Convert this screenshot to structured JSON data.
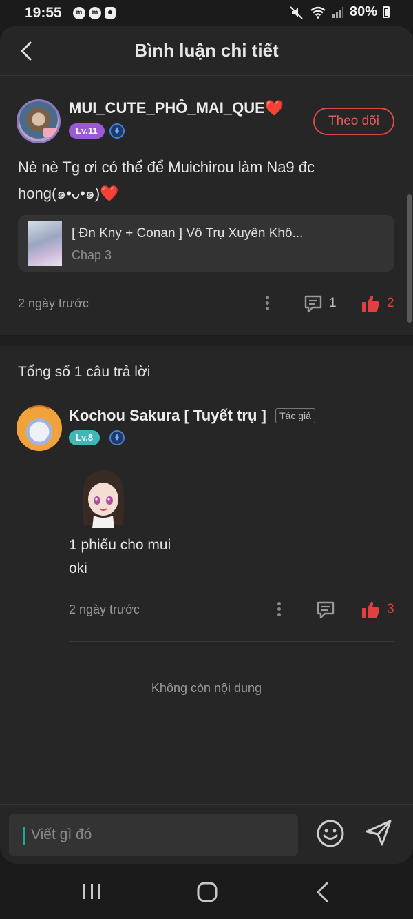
{
  "status_bar": {
    "time": "19:55",
    "app_icons": [
      "m-badge-icon",
      "m-badge-icon",
      "screen-record-icon"
    ],
    "battery": "80%",
    "system_icons": [
      "mute-icon",
      "wifi-icon",
      "signal-icon",
      "battery-icon"
    ]
  },
  "header": {
    "title": "Bình luận chi tiết",
    "back_icon": "chevron-left-icon"
  },
  "comment": {
    "username": "MUI_CUTE_PHÔ_MAI_QUE",
    "username_emoji": "❤️",
    "level": "Lv.11",
    "follow_label": "Theo dõi",
    "text_line1": "Nè nè Tg ơi có thể để Muichirou làm Na9 đc",
    "text_line2": "hong(๑•ᴗ•๑)",
    "text_emoji": "❤️",
    "story_title": "[ Đn Kny + Conan ] Vô Trụ Xuyên Khô...",
    "story_chap": "Chap 3",
    "time": "2 ngày trước",
    "reply_count": "1",
    "like_count": "2"
  },
  "replies_header": "Tổng số 1 câu trả lời",
  "reply": {
    "username": "Kochou Sakura [ Tuyết trụ ]",
    "author_tag": "Tác giả",
    "level": "Lv.8",
    "text_line1": "1 phiếu cho mui",
    "text_line2": "oki",
    "time": "2 ngày trước",
    "like_count": "3"
  },
  "end_text": "Không còn nội dung",
  "composer": {
    "placeholder": "Viết gì đó"
  },
  "colors": {
    "background": "#262626",
    "accent_red": "#e24040",
    "level_purple": "#9b59d6",
    "level_teal": "#3fb6b8",
    "text_muted": "#9a9a9a"
  }
}
